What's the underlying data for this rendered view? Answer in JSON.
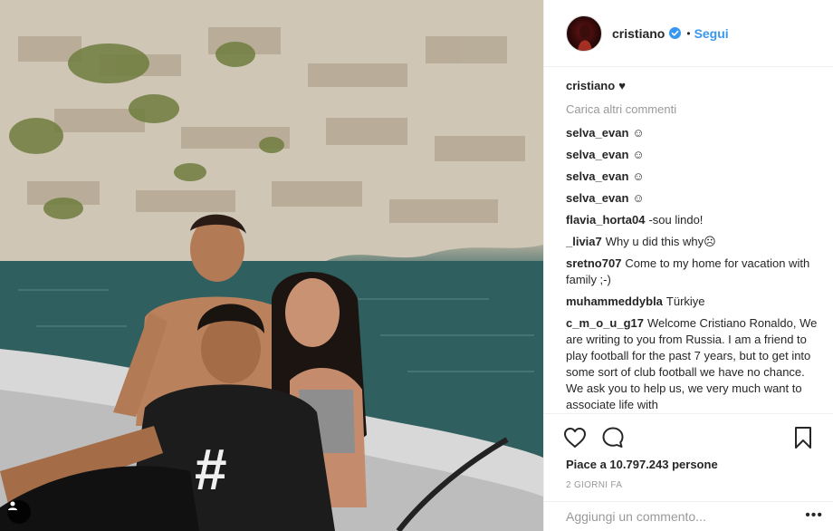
{
  "post": {
    "username": "cristiano",
    "follow_label": "Segui",
    "separator": "•",
    "caption_text": "♥",
    "load_more": "Carica altri commenti",
    "comments": [
      {
        "user": "selva_evan",
        "text": "☺"
      },
      {
        "user": "selva_evan",
        "text": "☺"
      },
      {
        "user": "selva_evan",
        "text": "☺"
      },
      {
        "user": "selva_evan",
        "text": "☺"
      },
      {
        "user": "flavia_horta04",
        "text": "-sou lindo!"
      },
      {
        "user": "_livia7",
        "text": "Why u did this why☹"
      },
      {
        "user": "sretno707",
        "text": "Come to my home for vacation with family ;-)"
      },
      {
        "user": "muhammeddybla",
        "text": "Türkiye"
      },
      {
        "user": "c_m_o_u_g17",
        "text": "Welcome Cristiano Ronaldo, We are writing to you from Russia. I am a friend to play football for the past 7 years, but to get into some sort of club football we have no chance. We ask you to help us, we very much want to associate life with"
      }
    ],
    "likes": "Piace a 10.797.243 persone",
    "date": "2 GIORNI FA",
    "comment_placeholder": "Aggiungi un commento...",
    "more_label": "•••"
  },
  "icons": {
    "verified": "verified-badge-icon",
    "like": "heart-icon",
    "comment": "comment-bubble-icon",
    "save": "bookmark-icon",
    "tag": "user-tag-icon"
  },
  "colors": {
    "link_blue": "#3897f0",
    "text": "#262626",
    "muted": "#999999",
    "border": "#efefef"
  }
}
